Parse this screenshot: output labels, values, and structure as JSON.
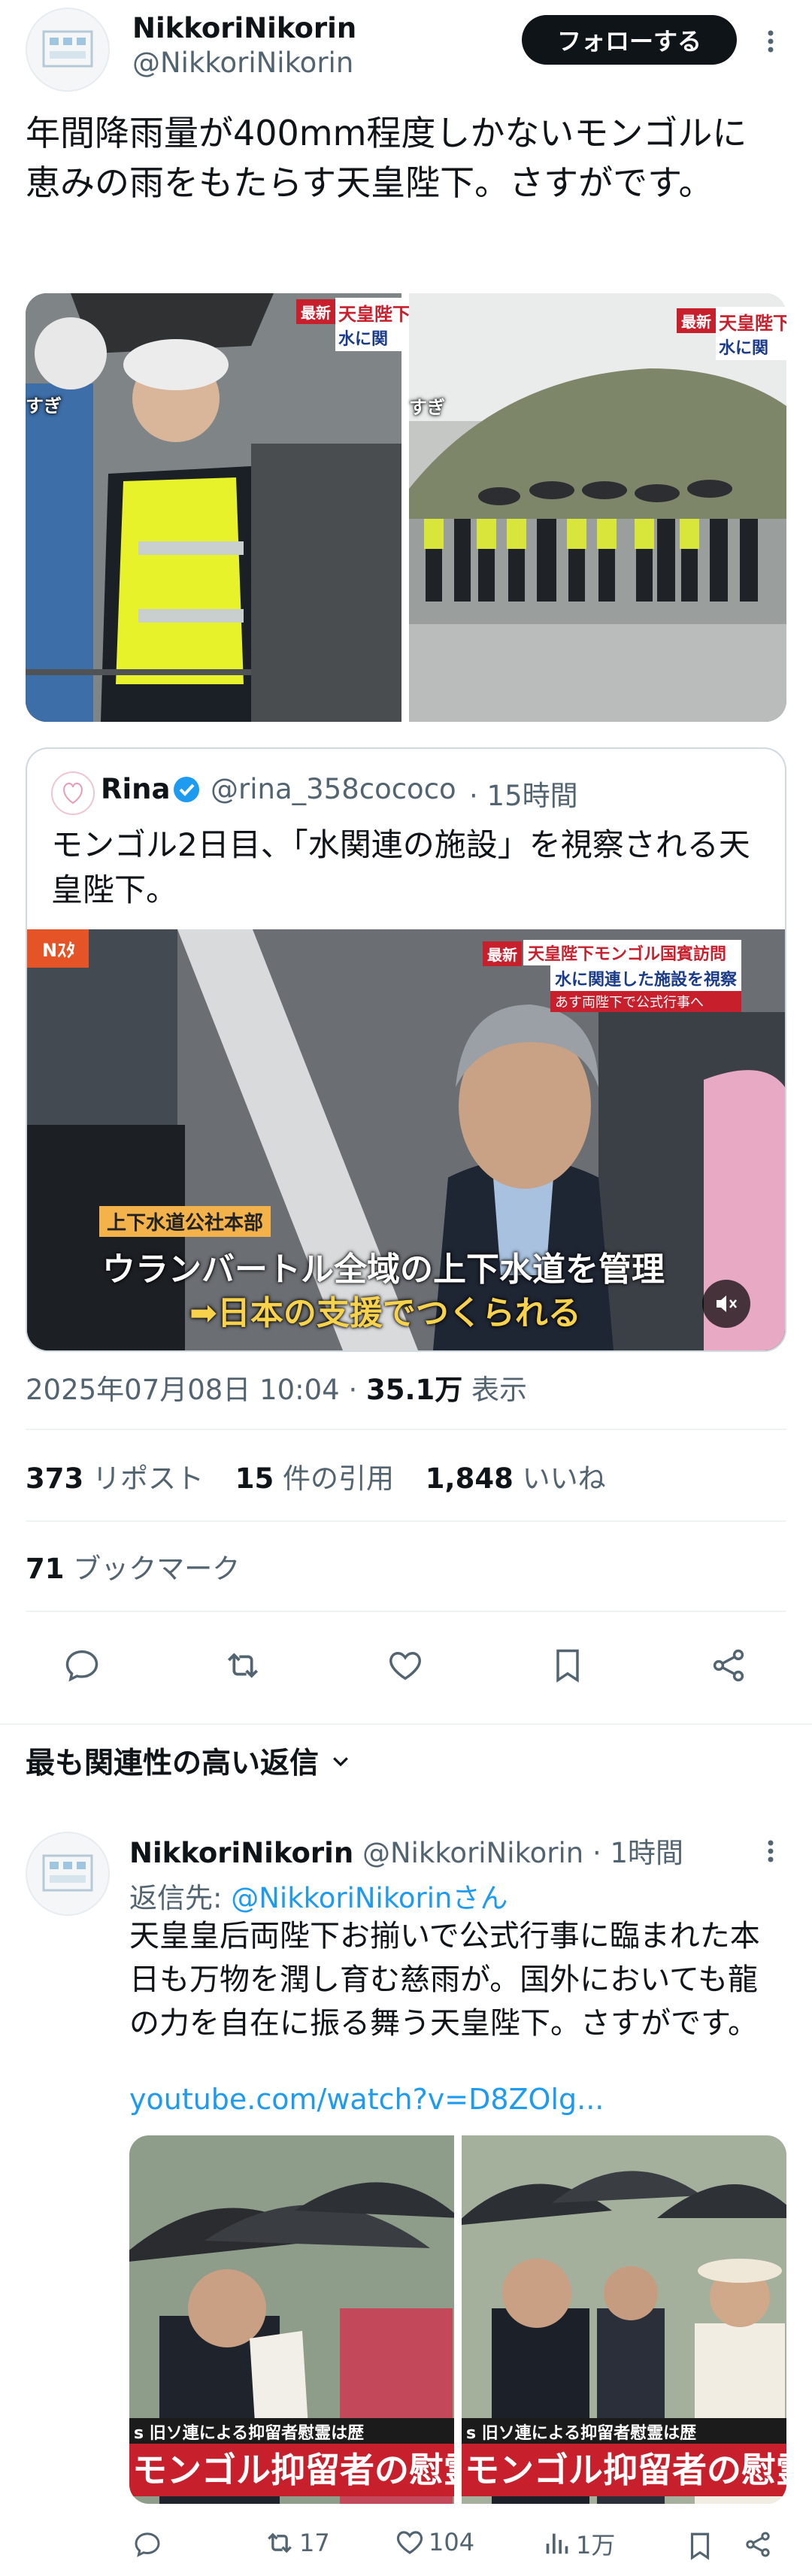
{
  "main_tweet": {
    "display_name": "NikkoriNikorin",
    "handle": "@NikkoriNikorin",
    "follow_label": "フォローする",
    "text": "年間降雨量が400mm程度しかないモンゴルに恵みの雨をもたらす天皇陛下。さすがです。",
    "image1_tags": {
      "badge": "最新",
      "headline1": "天皇陛下",
      "headline2": "水に関",
      "side": "すぎ"
    },
    "image2_tags": {
      "badge": "最新",
      "headline1": "天皇陛下",
      "headline2": "水に関",
      "side": "すぎ"
    }
  },
  "quote": {
    "display_name": "Rina",
    "handle": "@rina_358cococo",
    "time": "· 15時間",
    "text": "モンゴル2日目、「水関連の施設」を視察される天皇陛下。",
    "video": {
      "channel": "Nｽﾀ",
      "badge": "最新",
      "headline_top": "天皇陛下モンゴル国賓訪問",
      "headline_mid": "水に関連した施設を視察",
      "headline_sub": "あす両陛下で公式行事へ",
      "label": "上下水道公社本部",
      "caption1": "ウランバートル全域の上下水道を管理",
      "caption2": "➡日本の支援でつくられる"
    }
  },
  "meta": {
    "timestamp": "2025年07月08日 10:04 · ",
    "views": "35.1万",
    "views_label": " 表示"
  },
  "stats": {
    "reposts_count": "373",
    "reposts_label": " リポスト",
    "quotes_count": "15",
    "quotes_label": " 件の引用",
    "likes_count": "1,848",
    "likes_label": " いいね",
    "bookmarks_count": "71",
    "bookmarks_label": " ブックマーク"
  },
  "replies_header": "最も関連性の高い返信",
  "reply": {
    "display_name": "NikkoriNikorin",
    "handle": "@NikkoriNikorin",
    "time": "· 1時間",
    "reply_to_prefix": "返信先: ",
    "reply_to": "@NikkoriNikorinさん",
    "text": "天皇皇后両陛下お揃いで公式行事に臨まれた本日も万物を潤し育む慈雨が。国外においても龍の力を自在に振る舞う天皇陛下。さすがです。",
    "link": "youtube.com/watch?v=D8ZOlg...",
    "image1_caption_top": "s 旧ソ連による抑留者慰霊は歴",
    "image1_caption": "モンゴル抑留者の慰霊",
    "image2_caption_top": "s 旧ソ連による抑留者慰霊は歴",
    "image2_caption": "モンゴル抑留者の慰霊",
    "actions": {
      "reply": "",
      "repost": "17",
      "like": "104",
      "views": "1万"
    }
  },
  "colors": {
    "accent": "#1d9bf0",
    "text": "#0f1419",
    "muted": "#536471",
    "verified": "#1d9bf0",
    "news_red": "#c7202c"
  }
}
